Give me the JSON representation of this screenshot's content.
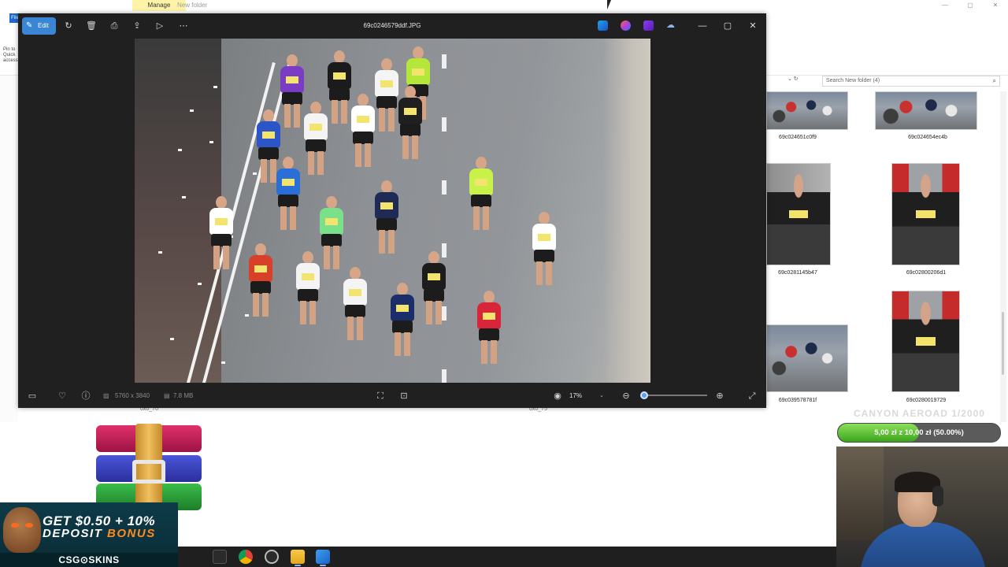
{
  "explorer": {
    "manage_tab": "Manage",
    "window_title": "New folder",
    "file_tab": "File",
    "pin_text": "Pin to Quick access",
    "search_placeholder": "Search New folder (4)",
    "thumbnails": [
      {
        "label": "69c024651c0f9"
      },
      {
        "label": "69c024654ec4b"
      },
      {
        "label": "69c0281145b47"
      },
      {
        "label": "69c02800206d1"
      },
      {
        "label": "69c039578781f"
      },
      {
        "label": "69c0280019729"
      }
    ],
    "stray_labels": [
      "0x0_70",
      "0x0_75"
    ]
  },
  "viewer": {
    "title": "69c0246579ddf.JPG",
    "edit_label": "Edit",
    "dimensions": "5760 x 3840",
    "file_size": "7.8 MB",
    "zoom": "17%",
    "zoom_level": 0.0
  },
  "stream": {
    "overlay_text": "CANYON AEROAD 1/2000",
    "donation_text": "5,00 zł z 10,00 zł (50.00%)",
    "donation_progress": 0.5,
    "promo_line1": "GET $0.50 + 10%",
    "promo_line2_a": "DEPOSIT",
    "promo_line2_b": "BONUS",
    "promo_brand": "CSG⊙SKINS"
  },
  "colors": {
    "accent": "#3a86d4",
    "viewer_bg": "#202020",
    "donation_green": "#3aa51b"
  }
}
